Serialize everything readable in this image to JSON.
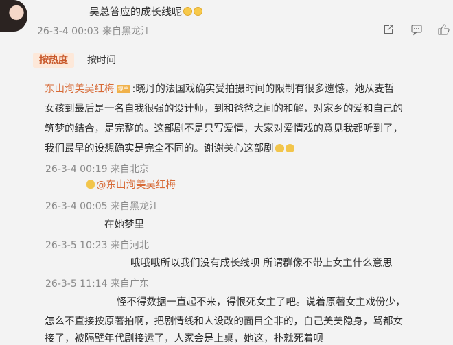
{
  "comment_top": {
    "text": "吴总答应的成长线呢",
    "emoji": "cry-emoji",
    "meta": "26-3-4 00:03 来自黑龙江"
  },
  "tabs": {
    "hot": "按热度",
    "time": "按时间"
  },
  "main_comment": {
    "author": "东山洵美吴红梅",
    "badge": "博主",
    "line1": ":晓丹的法国戏确实受拍摄时间的限制有很多遗憾，她从麦哲",
    "line2": "女孩到最后是一名自我很强的设计师，到和爸爸之间的和解，对家乡的爱和自己的",
    "line3": "筑梦的结合，是完整的。这部剧不是只写爱情，大家对爱情戏的意见我都听到了，",
    "line4": "我们最早的设想确实是完全不同的。谢谢关心这部剧",
    "meta": "26-3-4 00:19 来自北京"
  },
  "replies": [
    {
      "mention": "@东山洵美吴红梅",
      "meta": "26-3-4 00:05 来自黑龙江"
    },
    {
      "text": "在她梦里",
      "meta": "26-3-5 10:23 来自河北"
    },
    {
      "text": "哦哦哦所以我们没有成长线呗 所谓群像不带上女主什么意思",
      "meta": "26-3-5 11:14 来自广东"
    },
    {
      "line1": "怪不得数据一直起不来，得恨死女主了吧。说着原著女主戏份少，",
      "line2": "怎么不直接按原著拍啊，把剧情线和人设改的面目全非的，自己美美隐身，骂都女",
      "line3": "接了，被隔壁年代剧接运了，人家会是上桌，她这，扑就死着呗"
    }
  ],
  "actions": {
    "share": "share-icon",
    "comment": "comment-icon",
    "like": "like-icon"
  }
}
